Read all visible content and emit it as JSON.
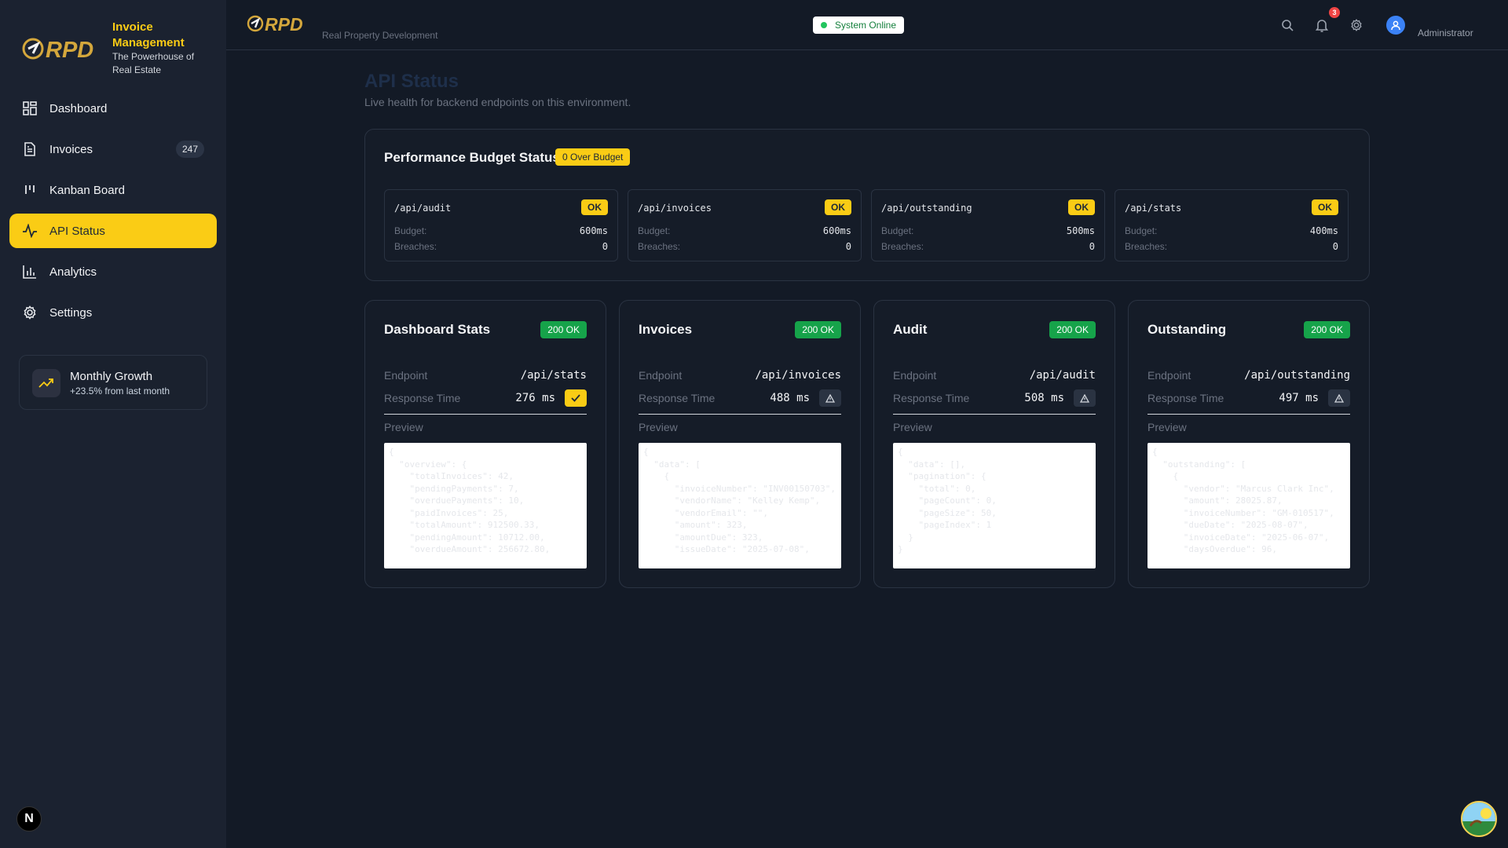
{
  "sidebar": {
    "brand_title": "Invoice Management",
    "brand_sub": "The Powerhouse of Real Estate",
    "logo_text": "RPD",
    "items": [
      {
        "label": "Dashboard",
        "icon": "grid-icon"
      },
      {
        "label": "Invoices",
        "icon": "file-icon",
        "count": "247"
      },
      {
        "label": "Kanban Board",
        "icon": "kanban-icon"
      },
      {
        "label": "API Status",
        "icon": "activity-icon",
        "active": true
      },
      {
        "label": "Analytics",
        "icon": "bar-chart-icon"
      },
      {
        "label": "Settings",
        "icon": "gear-icon"
      }
    ],
    "growth": {
      "title": "Monthly Growth",
      "sub": "+23.5% from last month"
    },
    "badge": "N"
  },
  "header": {
    "logo_text": "RPD",
    "subtitle": "Real Property Development",
    "status": "System Online",
    "notifications": "3",
    "user": "Administrator"
  },
  "page": {
    "title": "API Status",
    "subtitle": "Live health for backend endpoints on this environment."
  },
  "budget": {
    "title": "Performance Budget Status",
    "over_label": "0 Over Budget",
    "budget_label": "Budget:",
    "breaches_label": "Breaches:",
    "cards": [
      {
        "endpoint": "/api/audit",
        "status": "OK",
        "budget": "600ms",
        "breaches": "0"
      },
      {
        "endpoint": "/api/invoices",
        "status": "OK",
        "budget": "600ms",
        "breaches": "0"
      },
      {
        "endpoint": "/api/outstanding",
        "status": "OK",
        "budget": "500ms",
        "breaches": "0"
      },
      {
        "endpoint": "/api/stats",
        "status": "OK",
        "budget": "400ms",
        "breaches": "0"
      }
    ]
  },
  "services": {
    "endpoint_label": "Endpoint",
    "response_label": "Response Time",
    "preview_label": "Preview",
    "cards": [
      {
        "title": "Dashboard Stats",
        "code": "200 OK",
        "endpoint": "/api/stats",
        "response": "276 ms",
        "indicator": "check-icon",
        "preview": "{\n  \"overview\": {\n    \"totalInvoices\": 42,\n    \"pendingPayments\": 7,\n    \"overduePayments\": 10,\n    \"paidInvoices\": 25,\n    \"totalAmount\": 912500.33,\n    \"pendingAmount\": 10712.00,\n    \"overdueAmount\": 256672.80,"
      },
      {
        "title": "Invoices",
        "code": "200 OK",
        "endpoint": "/api/invoices",
        "response": "488 ms",
        "indicator": "warning-icon",
        "preview": "{\n  \"data\": [\n    {\n      \"invoiceNumber\": \"INV00150703\",\n      \"vendorName\": \"Kelley Kemp\",\n      \"vendorEmail\": \"\",\n      \"amount\": 323,\n      \"amountDue\": 323,\n      \"issueDate\": \"2025-07-08\","
      },
      {
        "title": "Audit",
        "code": "200 OK",
        "endpoint": "/api/audit",
        "response": "508 ms",
        "indicator": "warning-icon",
        "preview": "{\n  \"data\": [],\n  \"pagination\": {\n    \"total\": 0,\n    \"pageCount\": 0,\n    \"pageSize\": 50,\n    \"pageIndex\": 1\n  }\n}"
      },
      {
        "title": "Outstanding",
        "code": "200 OK",
        "endpoint": "/api/outstanding",
        "response": "497 ms",
        "indicator": "warning-icon",
        "preview": "{\n  \"outstanding\": [\n    {\n      \"vendor\": \"Marcus Clark Inc\",\n      \"amount\": 28025.87,\n      \"invoiceNumber\": \"GM-010517\",\n      \"dueDate\": \"2025-08-07\",\n      \"invoiceDate\": \"2025-06-07\",\n      \"daysOverdue\": 96,"
      }
    ]
  },
  "colors": {
    "accent": "#facc15",
    "bg": "#131a26",
    "sidebar": "#1b2230",
    "success": "#16a34a"
  }
}
